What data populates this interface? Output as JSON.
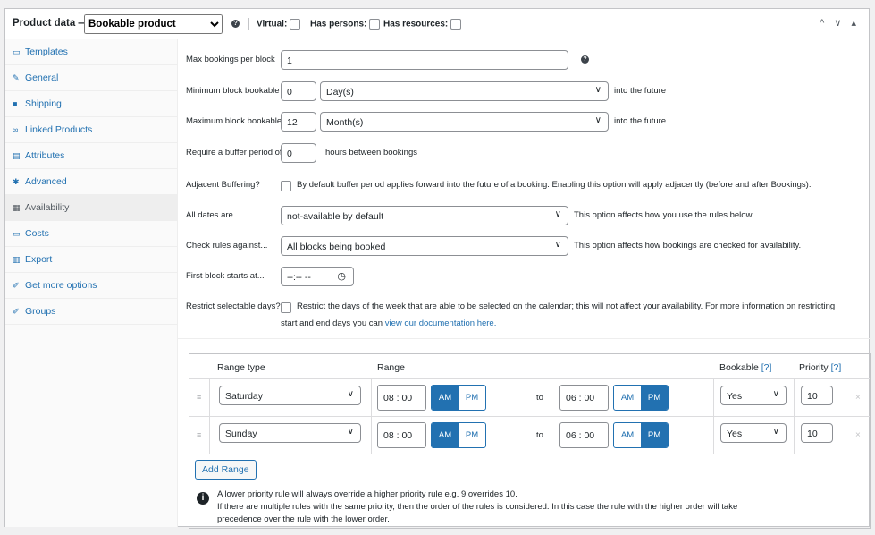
{
  "header": {
    "title": "Product data —",
    "product_type": "Bookable product",
    "help": "?",
    "virtual_label": "Virtual:",
    "has_persons_label": "Has persons:",
    "has_resources_label": "Has resources:",
    "arrows": "^ ∨ ▴"
  },
  "sidebar": {
    "items": [
      {
        "label": "Templates",
        "icon": "template-icon"
      },
      {
        "label": "General",
        "icon": "wrench-icon"
      },
      {
        "label": "Shipping",
        "icon": "truck-icon"
      },
      {
        "label": "Linked Products",
        "icon": "link-icon"
      },
      {
        "label": "Attributes",
        "icon": "list-icon"
      },
      {
        "label": "Advanced",
        "icon": "gear-icon"
      },
      {
        "label": "Availability",
        "icon": "calendar-icon"
      },
      {
        "label": "Costs",
        "icon": "money-icon"
      },
      {
        "label": "Export",
        "icon": "export-icon"
      },
      {
        "label": "Get more options",
        "icon": "plug-icon"
      },
      {
        "label": "Groups",
        "icon": "groups-icon"
      }
    ]
  },
  "fields": {
    "max_bookings_label": "Max bookings per block",
    "max_bookings_value": "1",
    "min_block_label": "Minimum block bookable",
    "min_block_value": "0",
    "min_block_unit": "Day(s)",
    "into_future": "into the future",
    "max_block_label": "Maximum block bookable",
    "max_block_value": "12",
    "max_block_unit": "Month(s)",
    "buffer_label": "Require a buffer period of",
    "buffer_value": "0",
    "buffer_suffix": "hours between bookings",
    "adjacent_label": "Adjacent Buffering?",
    "adjacent_desc": "By default buffer period applies forward into the future of a booking. Enabling this option will apply adjacently (before and after Bookings).",
    "all_dates_label": "All dates are...",
    "all_dates_value": "not-available by default",
    "all_dates_desc": "This option affects how you use the rules below.",
    "check_rules_label": "Check rules against...",
    "check_rules_value": "All blocks being booked",
    "check_rules_desc": "This option affects how bookings are checked for availability.",
    "first_block_label": "First block starts at...",
    "first_block_value": "--:-- --",
    "restrict_label": "Restrict selectable days?",
    "restrict_desc_1": "Restrict the days of the week that are able to be selected on the calendar; this will not affect your availability. For more information on restricting",
    "restrict_desc_2": "start and end days you can",
    "restrict_link": "view our documentation here."
  },
  "ranges": {
    "headers": {
      "range_type": "Range type",
      "range": "Range",
      "bookable": "Bookable",
      "priority": "Priority",
      "q": "[?]"
    },
    "to": "to",
    "am": "AM",
    "pm": "PM",
    "rows": [
      {
        "type": "Saturday",
        "from_h": "08",
        "from_m": "00",
        "to_h": "06",
        "to_m": "00",
        "bookable": "Yes",
        "priority": "10"
      },
      {
        "type": "Sunday",
        "from_h": "08",
        "from_m": "00",
        "to_h": "06",
        "to_m": "00",
        "bookable": "Yes",
        "priority": "10"
      }
    ],
    "add_range": "Add Range",
    "info_1": "A lower priority rule will always override a higher priority rule e.g. 9 overrides 10.",
    "info_2": "If there are multiple rules with the same priority, then the order of the rules is considered. In this case the rule with the higher order will take",
    "info_3": "precedence over the rule with the lower order."
  },
  "colors": {
    "accent": "#2271b1",
    "border": "#c3c4c7",
    "sidebar_bg": "#fafafa"
  }
}
